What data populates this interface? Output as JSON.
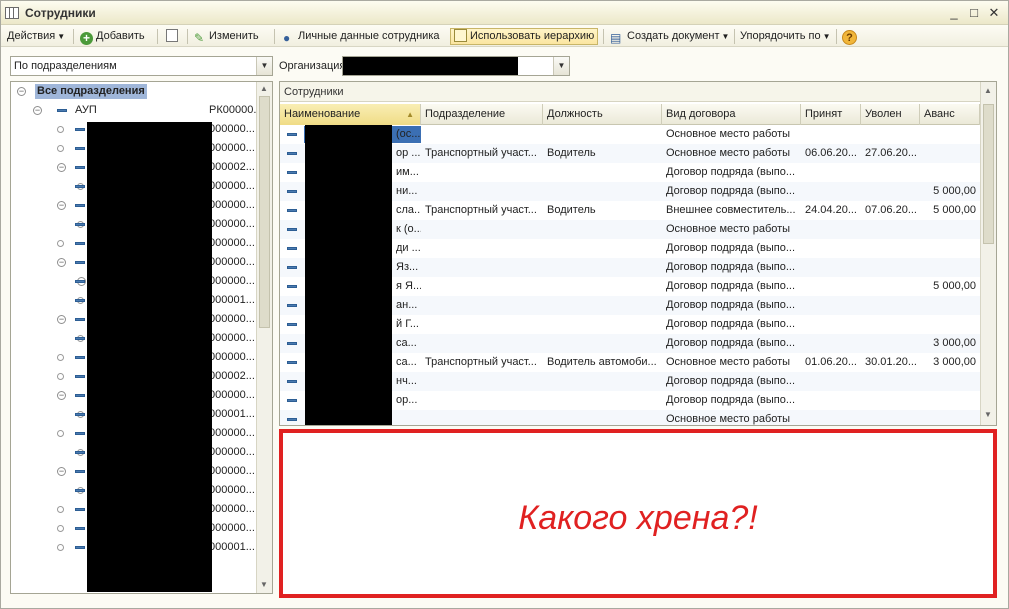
{
  "window": {
    "title": "Сотрудники",
    "buttons": {
      "minimize": "_",
      "maximize": "□",
      "close": "✕"
    }
  },
  "toolbar": {
    "actions": "Действия",
    "add": "Добавить",
    "edit": "Изменить",
    "personal_data": "Личные данные сотрудника",
    "use_hierarchy": "Использовать иерархию",
    "create_document": "Создать документ",
    "sort_by": "Упорядочить по",
    "help": "?"
  },
  "filters": {
    "view_mode": "По подразделениям",
    "organization_label": "Организация"
  },
  "tree": {
    "root": "Все подразделения",
    "items": [
      {
        "name": "АУП",
        "code": "РК00000...",
        "level": 1,
        "node": "minus"
      },
      {
        "code": "000000...",
        "level": 2,
        "node": "dot"
      },
      {
        "code": "000000...",
        "level": 2,
        "node": "dot"
      },
      {
        "code": "000002...",
        "level": 2,
        "node": "minus"
      },
      {
        "code": "000000...",
        "level": 3,
        "node": "dot"
      },
      {
        "code": "000000...",
        "level": 2,
        "node": "minus"
      },
      {
        "code": "000000...",
        "level": 3,
        "node": "dot"
      },
      {
        "code": "000000...",
        "level": 2,
        "node": "dot"
      },
      {
        "code": "000000...",
        "level": 2,
        "node": "minus"
      },
      {
        "code": "000000...",
        "level": 3,
        "node": "minus"
      },
      {
        "code": "000001...",
        "level": 3,
        "node": "dot"
      },
      {
        "code": "000000...",
        "level": 2,
        "node": "minus"
      },
      {
        "code": "000000...",
        "level": 3,
        "node": "dot"
      },
      {
        "code": "000000...",
        "level": 2,
        "node": "dot"
      },
      {
        "code": "000002...",
        "level": 2,
        "node": "dot"
      },
      {
        "code": "000000...",
        "level": 2,
        "node": "minus"
      },
      {
        "code": "000001...",
        "level": 3,
        "node": "dot"
      },
      {
        "code": "000000...",
        "level": 2,
        "node": "dot"
      },
      {
        "code": "000000...",
        "level": 3,
        "node": "dot"
      },
      {
        "code": "000000...",
        "level": 2,
        "node": "minus"
      },
      {
        "code": "000000...",
        "level": 3,
        "node": "dot"
      },
      {
        "code": "000000...",
        "level": 2,
        "node": "dot"
      },
      {
        "code": "000000...",
        "level": 2,
        "node": "dot"
      },
      {
        "code": "000001...",
        "level": 2,
        "node": "dot"
      }
    ]
  },
  "employees": {
    "panel_title": "Сотрудники",
    "columns": [
      "Наименование",
      "Подразделение",
      "Должность",
      "Вид договора",
      "Принят",
      "Уволен",
      "Аванс"
    ],
    "rows": [
      {
        "name": "(ос...",
        "dept": "",
        "position": "",
        "contract": "Основное место работы",
        "hired": "",
        "fired": "",
        "advance": ""
      },
      {
        "name": "ор ...",
        "dept": "Транспортный участ...",
        "position": "Водитель",
        "contract": "Основное место работы",
        "hired": "06.06.20...",
        "fired": "27.06.20...",
        "advance": ""
      },
      {
        "name": "им...",
        "dept": "",
        "position": "",
        "contract": "Договор подряда (выпо...",
        "hired": "",
        "fired": "",
        "advance": ""
      },
      {
        "name": "ни...",
        "dept": "",
        "position": "",
        "contract": "Договор подряда (выпо...",
        "hired": "",
        "fired": "",
        "advance": "5 000,00"
      },
      {
        "name": "сла...",
        "dept": "Транспортный участ...",
        "position": "Водитель",
        "contract": "Внешнее совместитель...",
        "hired": "24.04.20...",
        "fired": "07.06.20...",
        "advance": "5 000,00"
      },
      {
        "name": "к (о...",
        "dept": "",
        "position": "",
        "contract": "Основное место работы",
        "hired": "",
        "fired": "",
        "advance": ""
      },
      {
        "name": "ди ...",
        "dept": "",
        "position": "",
        "contract": "Договор подряда (выпо...",
        "hired": "",
        "fired": "",
        "advance": ""
      },
      {
        "name": "Яз...",
        "dept": "",
        "position": "",
        "contract": "Договор подряда (выпо...",
        "hired": "",
        "fired": "",
        "advance": ""
      },
      {
        "name": "я Я...",
        "dept": "",
        "position": "",
        "contract": "Договор подряда (выпо...",
        "hired": "",
        "fired": "",
        "advance": "5 000,00"
      },
      {
        "name": "ан...",
        "dept": "",
        "position": "",
        "contract": "Договор подряда (выпо...",
        "hired": "",
        "fired": "",
        "advance": ""
      },
      {
        "name": "й Г...",
        "dept": "",
        "position": "",
        "contract": "Договор подряда (выпо...",
        "hired": "",
        "fired": "",
        "advance": ""
      },
      {
        "name": "са...",
        "dept": "",
        "position": "",
        "contract": "Договор подряда (выпо...",
        "hired": "",
        "fired": "",
        "advance": "3 000,00"
      },
      {
        "name": "са...",
        "dept": "Транспортный участ...",
        "position": "Водитель автомоби...",
        "contract": "Основное место работы",
        "hired": "01.06.20...",
        "fired": "30.01.20...",
        "advance": "3 000,00"
      },
      {
        "name": "нч...",
        "dept": "",
        "position": "",
        "contract": "Договор подряда (выпо...",
        "hired": "",
        "fired": "",
        "advance": ""
      },
      {
        "name": "ор...",
        "dept": "",
        "position": "",
        "contract": "Договор подряда (выпо...",
        "hired": "",
        "fired": "",
        "advance": ""
      },
      {
        "name": "",
        "dept": "",
        "position": "",
        "contract": "Основное место работы",
        "hired": "",
        "fired": "",
        "advance": ""
      }
    ]
  },
  "annotation": {
    "text": "Какого хрена?!",
    "color": "#e02121"
  }
}
